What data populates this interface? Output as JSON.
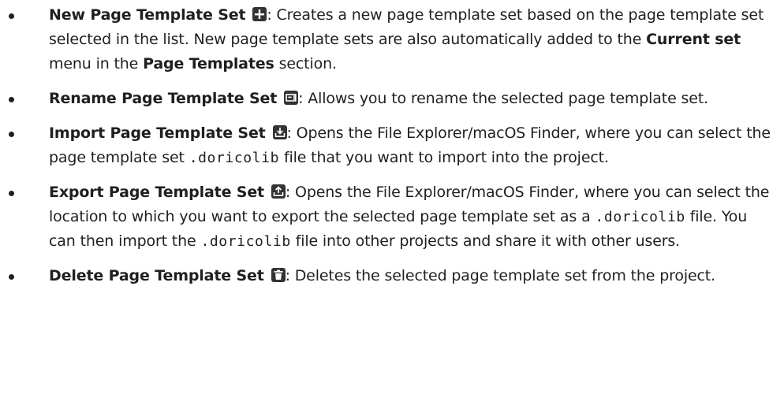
{
  "items": [
    {
      "name": "New Page Template Set",
      "icon": "plus-icon",
      "text_a": ": Creates a new page template set based on the page template set selected in the list. New page template sets are also automatically added to the ",
      "bold_1": "Current set",
      "text_b": " menu in the ",
      "bold_2": "Page Templates",
      "text_c": " section."
    },
    {
      "name": "Rename Page Template Set",
      "icon": "rename-icon",
      "text_a": ": Allows you to rename the selected page template set."
    },
    {
      "name": "Import Page Template Set",
      "icon": "import-icon",
      "text_a": ": Opens the File Explorer/macOS Finder, where you can select the page template set ",
      "code_1": ".doricolib",
      "text_b": " file that you want to import into the project."
    },
    {
      "name": "Export Page Template Set",
      "icon": "export-icon",
      "text_a": ": Opens the File Explorer/macOS Finder, where you can select the location to which you want to export the selected page template set as a ",
      "code_1": ".doricolib",
      "text_b": " file. You can then import the ",
      "code_2": ".doricolib",
      "text_c": " file into other projects and share it with other users."
    },
    {
      "name": "Delete Page Template Set",
      "icon": "trash-icon",
      "text_a": ": Deletes the selected page template set from the project."
    }
  ]
}
